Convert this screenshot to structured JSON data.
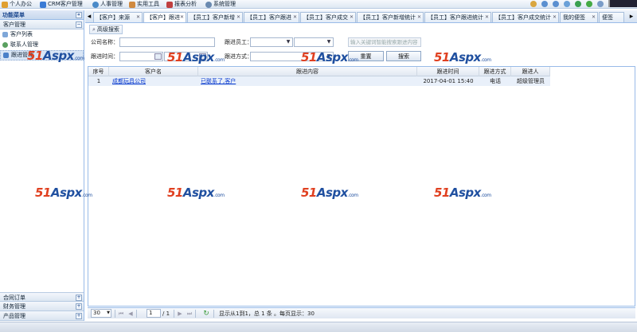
{
  "topmenu": [
    {
      "label": "个人办公",
      "icon": "home-icon",
      "color": "#e0a030"
    },
    {
      "label": "CRM客户管理",
      "icon": "crm-icon",
      "color": "#3a7bd5"
    },
    {
      "label": "人事管理",
      "icon": "people-icon",
      "color": "#4a8ac8"
    },
    {
      "label": "实用工具",
      "icon": "tools-icon",
      "color": "#d08a40"
    },
    {
      "label": "报表分析",
      "icon": "chart-icon",
      "color": "#c04040"
    },
    {
      "label": "系统管理",
      "icon": "settings-icon",
      "color": "#6a8ab0"
    }
  ],
  "sidebar": {
    "title": "功能菜单",
    "group": "客户管理",
    "items": [
      {
        "label": "客户列表",
        "icon": "list-icon"
      },
      {
        "label": "联系人管理",
        "icon": "contact-icon"
      },
      {
        "label": "跟进管理",
        "icon": "followup-icon"
      }
    ],
    "bottom_groups": [
      "合同订单",
      "财务管理",
      "产品管理"
    ]
  },
  "tabs": [
    "【客户】来源",
    "【客户】跟进",
    "【员工】客户新增",
    "【员工】客户跟进",
    "【员工】客户成交",
    "【员工】客户新增统计",
    "【员工】客户跟进统计",
    "【员工】客户成交统计",
    "我的便签",
    "便签"
  ],
  "toolbar": {
    "advanced_search": "高级搜索"
  },
  "form": {
    "customer_name_label": "公司名称：",
    "followup_staff_label": "跟进员工：",
    "followup_time_label": "跟进时间：",
    "followup_method_label": "跟进方式：",
    "keyword_placeholder": "输入关键词智能搜索跟进内容",
    "reset_button": "重置",
    "search_button": "搜索"
  },
  "grid": {
    "columns": [
      "序号",
      "客户名",
      "跟进内容",
      "跟进时间",
      "跟进方式",
      "跟进人"
    ],
    "rows": [
      {
        "no": "1",
        "customer": "成都玩具公司",
        "content": "已联系了,客户",
        "time": "2017-04-01 15:40",
        "method": "电话",
        "person": "超级管理员"
      }
    ]
  },
  "pager": {
    "page_size": "30",
    "page": "1",
    "total_pages": "/ 1",
    "info": "显示从1到1，总 1 条 。每页显示：30"
  },
  "watermark": {
    "num": "51",
    "brand": "Aspx",
    "dom": ".com"
  }
}
